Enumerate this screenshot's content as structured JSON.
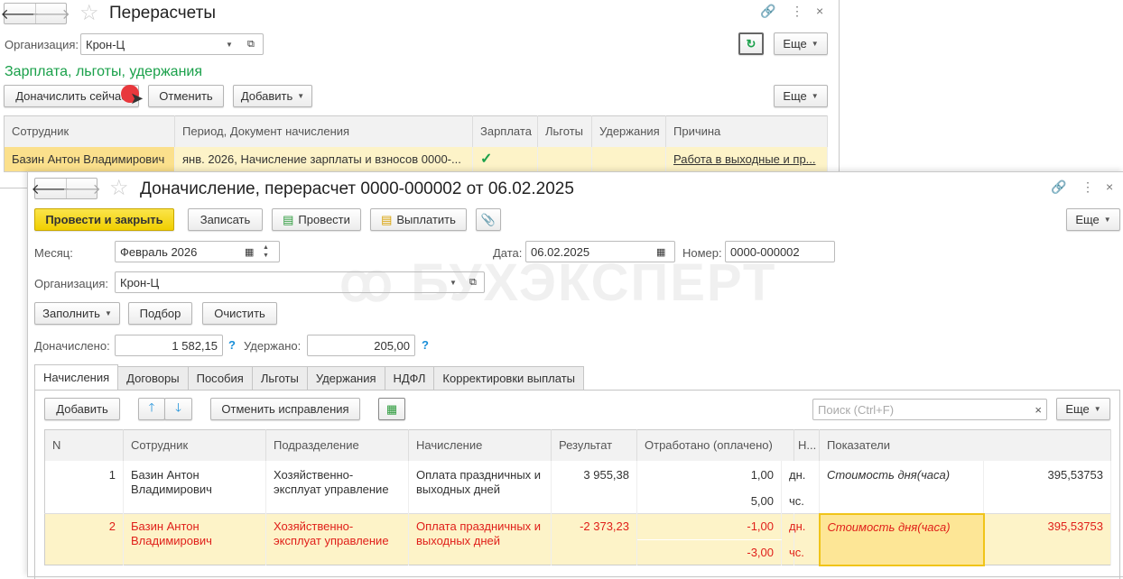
{
  "back_window": {
    "title": "Перерасчеты",
    "org_label": "Организация:",
    "org_value": "Крон-Ц",
    "more_label": "Еще",
    "section_title": "Зарплата, льготы, удержания",
    "buttons": {
      "accrue_now": "Доначислить сейчас",
      "cancel": "Отменить",
      "add": "Добавить",
      "more": "Еще"
    },
    "columns": [
      "Сотрудник",
      "Период, Документ начисления",
      "Зарплата",
      "Льготы",
      "Удержания",
      "Причина"
    ],
    "rows": [
      {
        "employee": "Базин Антон Владимирович",
        "period_doc": "янв. 2026, Начисление зарплаты и взносов 0000-...",
        "salary": "✓",
        "benefits": "",
        "deductions": "",
        "reason": "Работа в выходные и пр..."
      }
    ]
  },
  "front_window": {
    "title": "Доначисление, перерасчет 0000-000002 от 06.02.2025",
    "toolbar": {
      "post_close": "Провести и закрыть",
      "save": "Записать",
      "post": "Провести",
      "pay": "Выплатить",
      "more": "Еще"
    },
    "month_label": "Месяц:",
    "month_value": "Февраль 2026",
    "date_label": "Дата:",
    "date_value": "06.02.2025",
    "number_label": "Номер:",
    "number_value": "0000-000002",
    "org_label": "Организация:",
    "org_value": "Крон-Ц",
    "fill_buttons": {
      "fill": "Заполнить",
      "select": "Подбор",
      "clear": "Очистить"
    },
    "accrued_label": "Доначислено:",
    "accrued_value": "1 582,15",
    "withheld_label": "Удержано:",
    "withheld_value": "205,00",
    "help": "?",
    "watermark": "БУХЭКСПЕРТ",
    "tabs": [
      "Начисления",
      "Договоры",
      "Пособия",
      "Льготы",
      "Удержания",
      "НДФЛ",
      "Корректировки выплаты"
    ],
    "table_toolbar": {
      "add": "Добавить",
      "cancel_fix": "Отменить исправления",
      "search_placeholder": "Поиск (Ctrl+F)",
      "more": "Еще"
    },
    "columns": [
      "N",
      "Сотрудник",
      "Подразделение",
      "Начисление",
      "Результат",
      "Отработано (оплачено)",
      "Н...",
      "Показатели"
    ],
    "rows": [
      {
        "n": "1",
        "employee": "Базин Антон Владимирович",
        "dept": "Хозяйственно-эксплуат управление",
        "accrual": "Оплата праздничных и выходных дней",
        "result": "3 955,38",
        "days": "1,00",
        "days_unit": "дн.",
        "hours": "5,00",
        "hours_unit": "чс.",
        "indicator": "Стоимость дня(часа)",
        "indicator_value": "395,53753"
      },
      {
        "n": "2",
        "employee": "Базин Антон Владимирович",
        "dept": "Хозяйственно-эксплуат управление",
        "accrual": "Оплата праздничных и выходных дней",
        "result": "-2 373,23",
        "days": "-1,00",
        "days_unit": "дн.",
        "hours": "-3,00",
        "hours_unit": "чс.",
        "indicator": "Стоимость дня(часа)",
        "indicator_value": "395,53753"
      }
    ]
  },
  "colors": {
    "accent_yellow": "#f5d400",
    "section_green": "#1aa04a",
    "selected_row": "#fdf3c8",
    "negative_red": "#e0201a"
  }
}
